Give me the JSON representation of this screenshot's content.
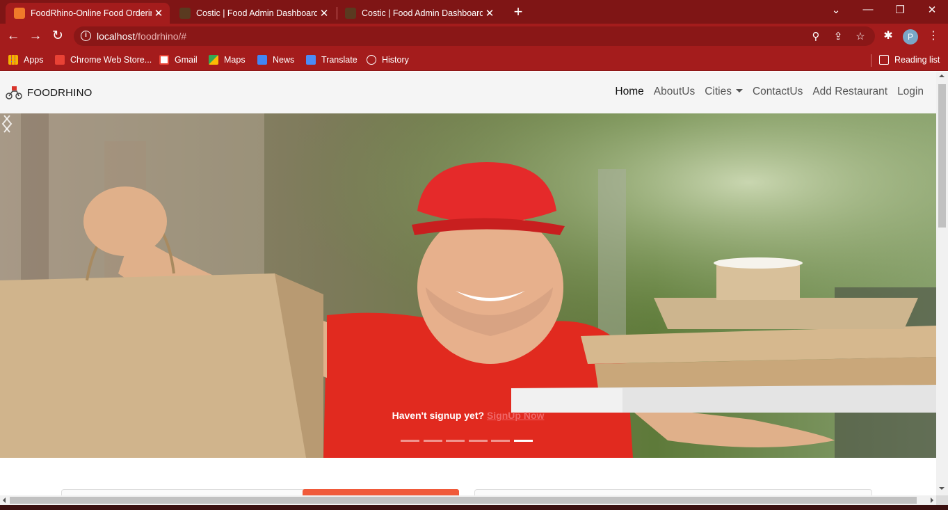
{
  "browser": {
    "tabs": [
      {
        "title": "FoodRhino-Online Food Ordering",
        "active": true
      },
      {
        "title": "Costic | Food Admin Dashboard A",
        "active": false
      },
      {
        "title": "Costic | Food Admin Dashboard A",
        "active": false
      }
    ],
    "url_host": "localhost",
    "url_path": "/foodrhino/#",
    "profile_initial": "P",
    "bookmarks": [
      "Apps",
      "Chrome Web Store...",
      "Gmail",
      "Maps",
      "News",
      "Translate",
      "History"
    ],
    "reading_list": "Reading list",
    "theme_color": "#a41c1c"
  },
  "site": {
    "brand": "FOODRHINO",
    "nav": {
      "home": "Home",
      "about": "AboutUs",
      "cities": "Cities",
      "contact": "ContactUs",
      "add_restaurant": "Add Restaurant",
      "login": "Login"
    },
    "hero": {
      "caption_text": "Haven't signup yet? ",
      "caption_link": "SignUp Now",
      "slide_count": 6,
      "active_slide": 6
    }
  }
}
